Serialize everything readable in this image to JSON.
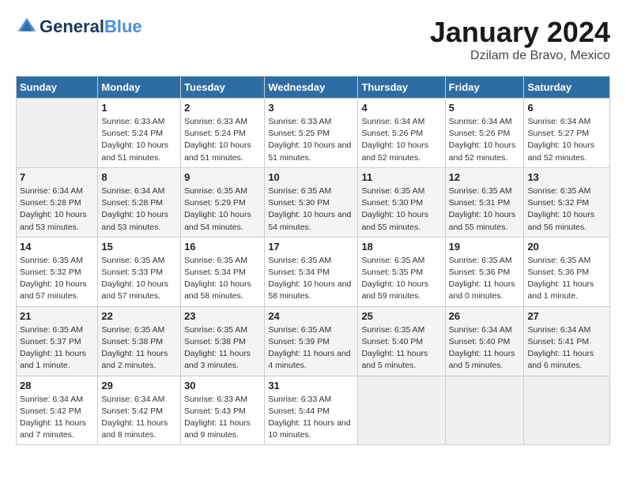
{
  "header": {
    "logo_line1": "General",
    "logo_line2": "Blue",
    "month": "January 2024",
    "location": "Dzilam de Bravo, Mexico"
  },
  "weekdays": [
    "Sunday",
    "Monday",
    "Tuesday",
    "Wednesday",
    "Thursday",
    "Friday",
    "Saturday"
  ],
  "weeks": [
    [
      {
        "day": "",
        "empty": true
      },
      {
        "day": "1",
        "sunrise": "6:33 AM",
        "sunset": "5:24 PM",
        "daylight": "10 hours and 51 minutes."
      },
      {
        "day": "2",
        "sunrise": "6:33 AM",
        "sunset": "5:24 PM",
        "daylight": "10 hours and 51 minutes."
      },
      {
        "day": "3",
        "sunrise": "6:33 AM",
        "sunset": "5:25 PM",
        "daylight": "10 hours and 51 minutes."
      },
      {
        "day": "4",
        "sunrise": "6:34 AM",
        "sunset": "5:26 PM",
        "daylight": "10 hours and 52 minutes."
      },
      {
        "day": "5",
        "sunrise": "6:34 AM",
        "sunset": "5:26 PM",
        "daylight": "10 hours and 52 minutes."
      },
      {
        "day": "6",
        "sunrise": "6:34 AM",
        "sunset": "5:27 PM",
        "daylight": "10 hours and 52 minutes."
      }
    ],
    [
      {
        "day": "7",
        "sunrise": "6:34 AM",
        "sunset": "5:28 PM",
        "daylight": "10 hours and 53 minutes."
      },
      {
        "day": "8",
        "sunrise": "6:34 AM",
        "sunset": "5:28 PM",
        "daylight": "10 hours and 53 minutes."
      },
      {
        "day": "9",
        "sunrise": "6:35 AM",
        "sunset": "5:29 PM",
        "daylight": "10 hours and 54 minutes."
      },
      {
        "day": "10",
        "sunrise": "6:35 AM",
        "sunset": "5:30 PM",
        "daylight": "10 hours and 54 minutes."
      },
      {
        "day": "11",
        "sunrise": "6:35 AM",
        "sunset": "5:30 PM",
        "daylight": "10 hours and 55 minutes."
      },
      {
        "day": "12",
        "sunrise": "6:35 AM",
        "sunset": "5:31 PM",
        "daylight": "10 hours and 55 minutes."
      },
      {
        "day": "13",
        "sunrise": "6:35 AM",
        "sunset": "5:32 PM",
        "daylight": "10 hours and 56 minutes."
      }
    ],
    [
      {
        "day": "14",
        "sunrise": "6:35 AM",
        "sunset": "5:32 PM",
        "daylight": "10 hours and 57 minutes."
      },
      {
        "day": "15",
        "sunrise": "6:35 AM",
        "sunset": "5:33 PM",
        "daylight": "10 hours and 57 minutes."
      },
      {
        "day": "16",
        "sunrise": "6:35 AM",
        "sunset": "5:34 PM",
        "daylight": "10 hours and 58 minutes."
      },
      {
        "day": "17",
        "sunrise": "6:35 AM",
        "sunset": "5:34 PM",
        "daylight": "10 hours and 58 minutes."
      },
      {
        "day": "18",
        "sunrise": "6:35 AM",
        "sunset": "5:35 PM",
        "daylight": "10 hours and 59 minutes."
      },
      {
        "day": "19",
        "sunrise": "6:35 AM",
        "sunset": "5:36 PM",
        "daylight": "11 hours and 0 minutes."
      },
      {
        "day": "20",
        "sunrise": "6:35 AM",
        "sunset": "5:36 PM",
        "daylight": "11 hours and 1 minute."
      }
    ],
    [
      {
        "day": "21",
        "sunrise": "6:35 AM",
        "sunset": "5:37 PM",
        "daylight": "11 hours and 1 minute."
      },
      {
        "day": "22",
        "sunrise": "6:35 AM",
        "sunset": "5:38 PM",
        "daylight": "11 hours and 2 minutes."
      },
      {
        "day": "23",
        "sunrise": "6:35 AM",
        "sunset": "5:38 PM",
        "daylight": "11 hours and 3 minutes."
      },
      {
        "day": "24",
        "sunrise": "6:35 AM",
        "sunset": "5:39 PM",
        "daylight": "11 hours and 4 minutes."
      },
      {
        "day": "25",
        "sunrise": "6:35 AM",
        "sunset": "5:40 PM",
        "daylight": "11 hours and 5 minutes."
      },
      {
        "day": "26",
        "sunrise": "6:34 AM",
        "sunset": "5:40 PM",
        "daylight": "11 hours and 5 minutes."
      },
      {
        "day": "27",
        "sunrise": "6:34 AM",
        "sunset": "5:41 PM",
        "daylight": "11 hours and 6 minutes."
      }
    ],
    [
      {
        "day": "28",
        "sunrise": "6:34 AM",
        "sunset": "5:42 PM",
        "daylight": "11 hours and 7 minutes."
      },
      {
        "day": "29",
        "sunrise": "6:34 AM",
        "sunset": "5:42 PM",
        "daylight": "11 hours and 8 minutes."
      },
      {
        "day": "30",
        "sunrise": "6:33 AM",
        "sunset": "5:43 PM",
        "daylight": "11 hours and 9 minutes."
      },
      {
        "day": "31",
        "sunrise": "6:33 AM",
        "sunset": "5:44 PM",
        "daylight": "11 hours and 10 minutes."
      },
      {
        "day": "",
        "empty": true
      },
      {
        "day": "",
        "empty": true
      },
      {
        "day": "",
        "empty": true
      }
    ]
  ]
}
